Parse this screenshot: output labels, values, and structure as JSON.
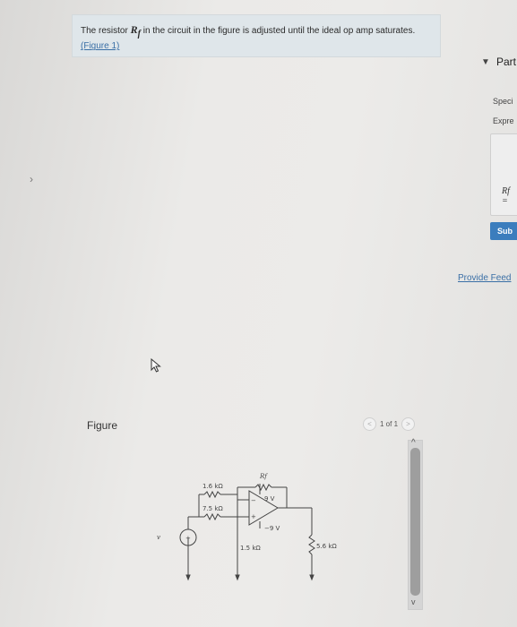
{
  "problem": {
    "text_before": "The resistor ",
    "variable": "R",
    "variable_sub": "f",
    "text_after": " in the circuit in the figure is adjusted until the ideal op amp saturates.",
    "figure_link": "(Figure 1)"
  },
  "figure": {
    "label": "Figure",
    "pager_text": "1 of 1",
    "prev_label": "<",
    "next_label": ">"
  },
  "circuit": {
    "rf_label": "Rf",
    "r1_label": "1.6 kΩ",
    "r2_label": "7.5 kΩ",
    "r3_label": "1.5 kΩ",
    "r4_label": "5.6 kΩ",
    "vpos_label": "9 V",
    "vneg_label": "−9 V",
    "vs_label": "v"
  },
  "right_panel": {
    "part_label": "Part",
    "spec_label": "Speci",
    "expr_label": "Expre",
    "answer_var": "Rf =",
    "submit_label": "Sub",
    "feedback_label": "Provide Feed"
  },
  "icons": {
    "collapse": "caret-down-icon",
    "cursor": "mouse-pointer-icon",
    "side_nav": "chevron-right-icon",
    "scroll_up": "chevron-up-icon",
    "scroll_down": "chevron-down-icon"
  }
}
